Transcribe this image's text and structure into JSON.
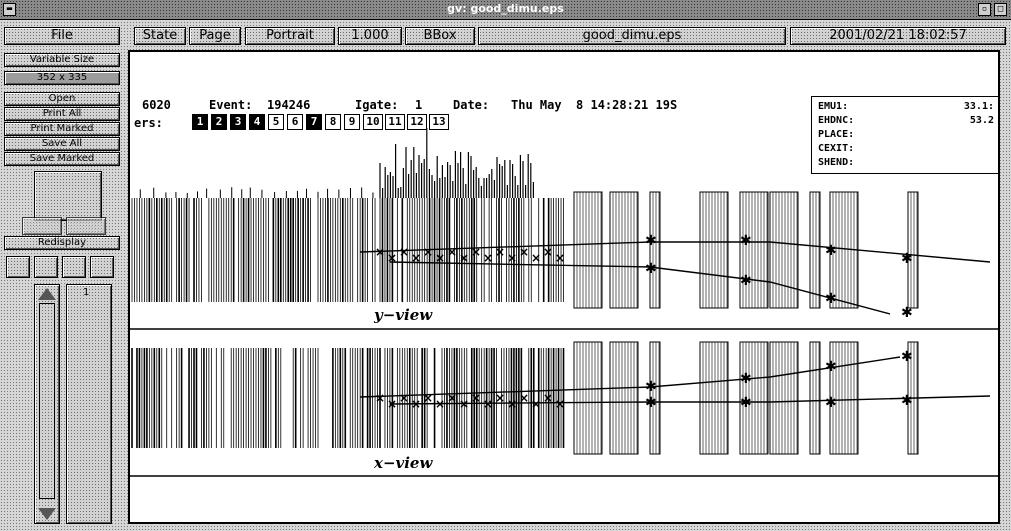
{
  "window": {
    "title": "gv: good_dimu.eps"
  },
  "toolbar": {
    "file": "File",
    "state": "State",
    "page": "Page",
    "orientation": "Portrait",
    "magnification": "1.000",
    "bbox": "BBox",
    "filename": "good_dimu.eps",
    "datetime": "2001/02/21 18:02:57"
  },
  "sidebar": {
    "variable_size": "Variable Size",
    "size": "352 x 335",
    "open": "Open",
    "print_all": "Print All",
    "print_marked": "Print Marked",
    "save_all": "Save All",
    "save_marked": "Save Marked",
    "redisplay": "Redisplay",
    "page_number": "1"
  },
  "event_header": {
    "run": "6020",
    "event_label": "Event:",
    "event": "194246",
    "igate_label": "Igate:",
    "igate": "1",
    "date_label": "Date:",
    "date": "Thu May  8 14:28:21 19S",
    "layers_label": "ers:",
    "layers": [
      {
        "n": "1",
        "on": true
      },
      {
        "n": "2",
        "on": true
      },
      {
        "n": "3",
        "on": true
      },
      {
        "n": "4",
        "on": true
      },
      {
        "n": "5",
        "on": false
      },
      {
        "n": "6",
        "on": false
      },
      {
        "n": "7",
        "on": true
      },
      {
        "n": "8",
        "on": false
      },
      {
        "n": "9",
        "on": false
      },
      {
        "n": "10",
        "on": false
      },
      {
        "n": "11",
        "on": false
      },
      {
        "n": "12",
        "on": false
      },
      {
        "n": "13",
        "on": false
      }
    ]
  },
  "info_box": [
    {
      "key": "EMU1:",
      "value": "33.1:"
    },
    {
      "key": "EHDNC:",
      "value": "53.2"
    },
    {
      "key": "PLACE:",
      "value": ""
    },
    {
      "key": "CEXIT:",
      "value": ""
    },
    {
      "key": "SHEND:",
      "value": ""
    }
  ],
  "views": {
    "y": "y−view",
    "x": "x−view"
  }
}
